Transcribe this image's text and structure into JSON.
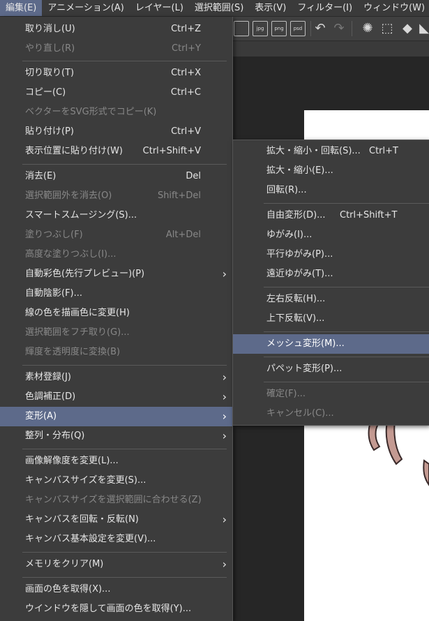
{
  "menubar": [
    "編集(E)",
    "アニメーション(A)",
    "レイヤー(L)",
    "選択範囲(S)",
    "表示(V)",
    "フィルター(I)",
    "ウィンドウ(W)"
  ],
  "toolbar": {
    "export_jpg": "jpg",
    "export_png": "png",
    "export_psd": "psd"
  },
  "edit_menu": {
    "undo": {
      "label": "取り消し(U)",
      "shortcut": "Ctrl+Z"
    },
    "redo": {
      "label": "やり直し(R)",
      "shortcut": "Ctrl+Y"
    },
    "cut": {
      "label": "切り取り(T)",
      "shortcut": "Ctrl+X"
    },
    "copy": {
      "label": "コピー(C)",
      "shortcut": "Ctrl+C"
    },
    "copy_svg": {
      "label": "ベクターをSVG形式でコピー(K)"
    },
    "paste": {
      "label": "貼り付け(P)",
      "shortcut": "Ctrl+V"
    },
    "paste_in_place": {
      "label": "表示位置に貼り付け(W)",
      "shortcut": "Ctrl+Shift+V"
    },
    "clear": {
      "label": "消去(E)",
      "shortcut": "Del"
    },
    "clear_outside": {
      "label": "選択範囲外を消去(O)",
      "shortcut": "Shift+Del"
    },
    "smart_smoothing": {
      "label": "スマートスムージング(S)..."
    },
    "fill": {
      "label": "塗りつぶし(F)",
      "shortcut": "Alt+Del"
    },
    "advanced_fill": {
      "label": "高度な塗りつぶし(I)..."
    },
    "auto_color": {
      "label": "自動彩色(先行プレビュー)(P)"
    },
    "auto_shading": {
      "label": "自動陰影(F)..."
    },
    "line_color_to_draw": {
      "label": "線の色を描画色に変更(H)"
    },
    "stroke_selection": {
      "label": "選択範囲をフチ取り(G)..."
    },
    "luminance_to_opacity": {
      "label": "輝度を透明度に変換(B)"
    },
    "register_material": {
      "label": "素材登録(J)"
    },
    "tonal_correction": {
      "label": "色調補正(D)"
    },
    "transform": {
      "label": "変形(A)"
    },
    "align_distribute": {
      "label": "整列・分布(Q)"
    },
    "change_resolution": {
      "label": "画像解像度を変更(L)..."
    },
    "change_canvas_size": {
      "label": "キャンバスサイズを変更(S)..."
    },
    "fit_canvas_to_selection": {
      "label": "キャンバスサイズを選択範囲に合わせる(Z)"
    },
    "rotate_flip_canvas": {
      "label": "キャンバスを回転・反転(N)"
    },
    "canvas_basic_settings": {
      "label": "キャンバス基本設定を変更(V)..."
    },
    "clear_memory": {
      "label": "メモリをクリア(M)"
    },
    "obtain_screen_color": {
      "label": "画面の色を取得(X)..."
    },
    "obtain_color_hide_window": {
      "label": "ウインドウを隠して画面の色を取得(Y)..."
    }
  },
  "transform_menu": {
    "scale_rotate": {
      "label": "拡大・縮小・回転(S)...",
      "shortcut": "Ctrl+T"
    },
    "scale": {
      "label": "拡大・縮小(E)..."
    },
    "rotate": {
      "label": "回転(R)..."
    },
    "free_transform": {
      "label": "自由変形(D)...",
      "shortcut": "Ctrl+Shift+T"
    },
    "distort": {
      "label": "ゆがみ(I)..."
    },
    "skew": {
      "label": "平行ゆがみ(P)..."
    },
    "perspective": {
      "label": "遠近ゆがみ(T)..."
    },
    "flip_horizontal": {
      "label": "左右反転(H)..."
    },
    "flip_vertical": {
      "label": "上下反転(V)..."
    },
    "mesh_transform": {
      "label": "メッシュ変形(M)..."
    },
    "puppet_warp": {
      "label": "パペット変形(P)..."
    },
    "commit": {
      "label": "確定(F)..."
    },
    "cancel": {
      "label": "キャンセル(C)..."
    }
  },
  "colors": {
    "highlight": "#5d6a8a",
    "menu_bg": "#3c3c3c",
    "disabled_text": "#888888"
  }
}
